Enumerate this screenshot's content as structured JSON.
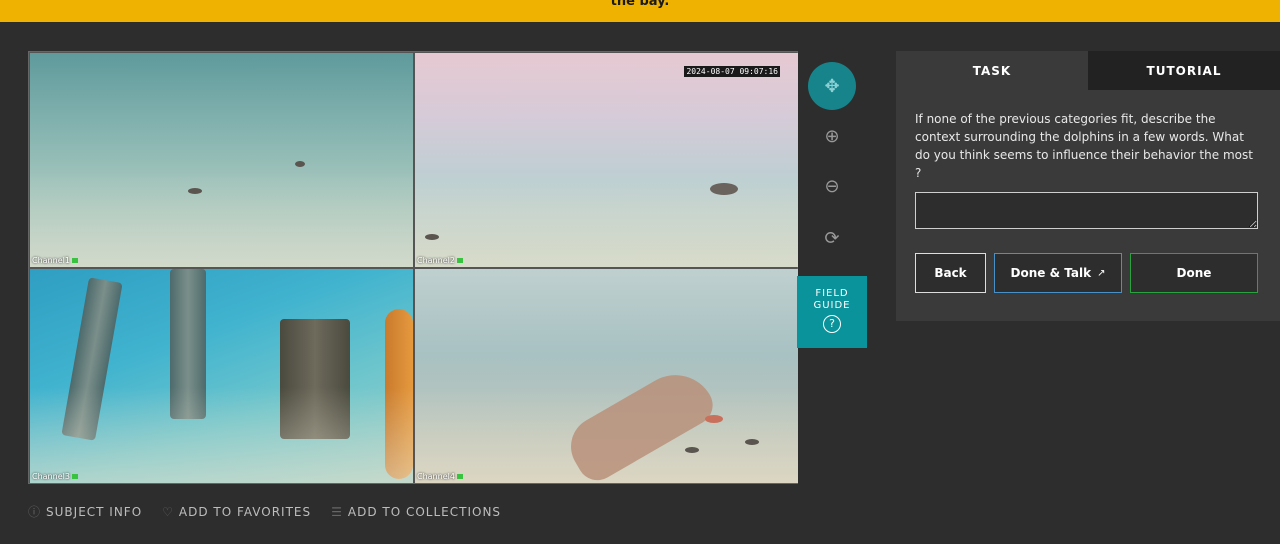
{
  "banner": {
    "text": "the bay."
  },
  "viewer": {
    "cameras": [
      {
        "label": "Channel1"
      },
      {
        "label": "Channel2",
        "timestamp": "2024-08-07 09:07:16"
      },
      {
        "label": "Channel3"
      },
      {
        "label": "Channel4"
      }
    ]
  },
  "toolbar": {
    "move_icon": "✥",
    "zoom_in_icon": "⊕",
    "zoom_out_icon": "⊖",
    "reset_icon": "⟳"
  },
  "field_guide": {
    "label_line1": "FIELD",
    "label_line2": "GUIDE",
    "icon": "?"
  },
  "task": {
    "tabs": [
      "TASK",
      "TUTORIAL"
    ],
    "question": "If none of the previous categories fit, describe the context surrounding the dolphins in a few words. What do you think seems to influence their behavior the most ?",
    "answer_value": "",
    "buttons": {
      "back": "Back",
      "done_talk": "Done & Talk",
      "done": "Done"
    }
  },
  "meta": {
    "subject_info": "SUBJECT INFO",
    "favorites": "ADD TO FAVORITES",
    "collections": "ADD TO COLLECTIONS"
  },
  "colors": {
    "banner": "#f0b200",
    "accent_teal": "#0a939b",
    "done_talk_border": "#4a90c8",
    "done_border": "#2aa33e"
  }
}
